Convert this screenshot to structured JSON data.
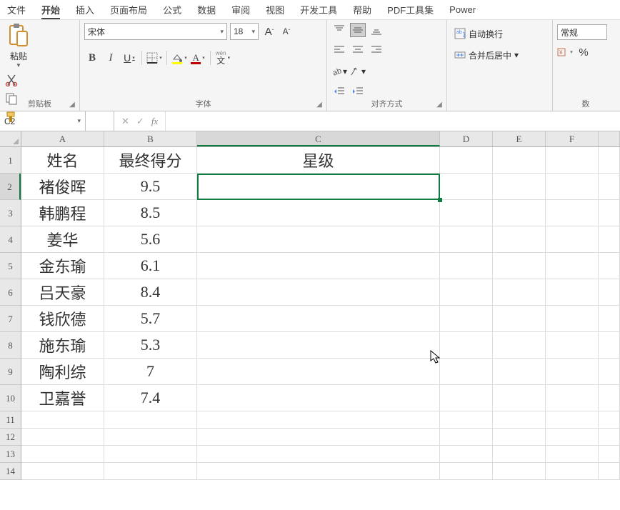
{
  "menu": {
    "tabs": [
      "文件",
      "开始",
      "插入",
      "页面布局",
      "公式",
      "数据",
      "审阅",
      "视图",
      "开发工具",
      "帮助",
      "PDF工具集",
      "Power "
    ],
    "active_index": 1
  },
  "ribbon": {
    "clipboard": {
      "paste_label": "粘贴",
      "group_label": "剪贴板"
    },
    "font": {
      "name": "宋体",
      "size": "18",
      "group_label": "字体",
      "buttons": {
        "bold": "B",
        "italic": "I",
        "underline": "U",
        "grow": "A",
        "shrink": "A",
        "pinyin_top": "wén",
        "pinyin_bottom": "文"
      }
    },
    "align": {
      "group_label": "对齐方式"
    },
    "wrap": {
      "wrap_label": "自动换行",
      "merge_label": "合并后居中"
    },
    "number": {
      "format": "常规",
      "group_label": "数"
    }
  },
  "formula_bar": {
    "cell_ref": "C2",
    "cancel": "✕",
    "confirm": "✓",
    "fx": "fx",
    "value": ""
  },
  "grid": {
    "columns": [
      "A",
      "B",
      "C",
      "D",
      "E",
      "F"
    ],
    "selected_col_index": 2,
    "selected_row_index": 1,
    "headers": {
      "A": "姓名",
      "B": "最终得分",
      "C": "星级"
    },
    "rows": [
      {
        "A": "褚俊晖",
        "B": "9.5"
      },
      {
        "A": "韩鹏程",
        "B": "8.5"
      },
      {
        "A": "姜华",
        "B": "5.6"
      },
      {
        "A": "金东瑜",
        "B": "6.1"
      },
      {
        "A": "吕天豪",
        "B": "8.4"
      },
      {
        "A": "钱欣德",
        "B": "5.7"
      },
      {
        "A": "施东瑜",
        "B": "5.3"
      },
      {
        "A": "陶利综",
        "B": "7"
      },
      {
        "A": "卫嘉誉",
        "B": "7.4"
      }
    ],
    "empty_rows": [
      11,
      12,
      13,
      14
    ]
  }
}
